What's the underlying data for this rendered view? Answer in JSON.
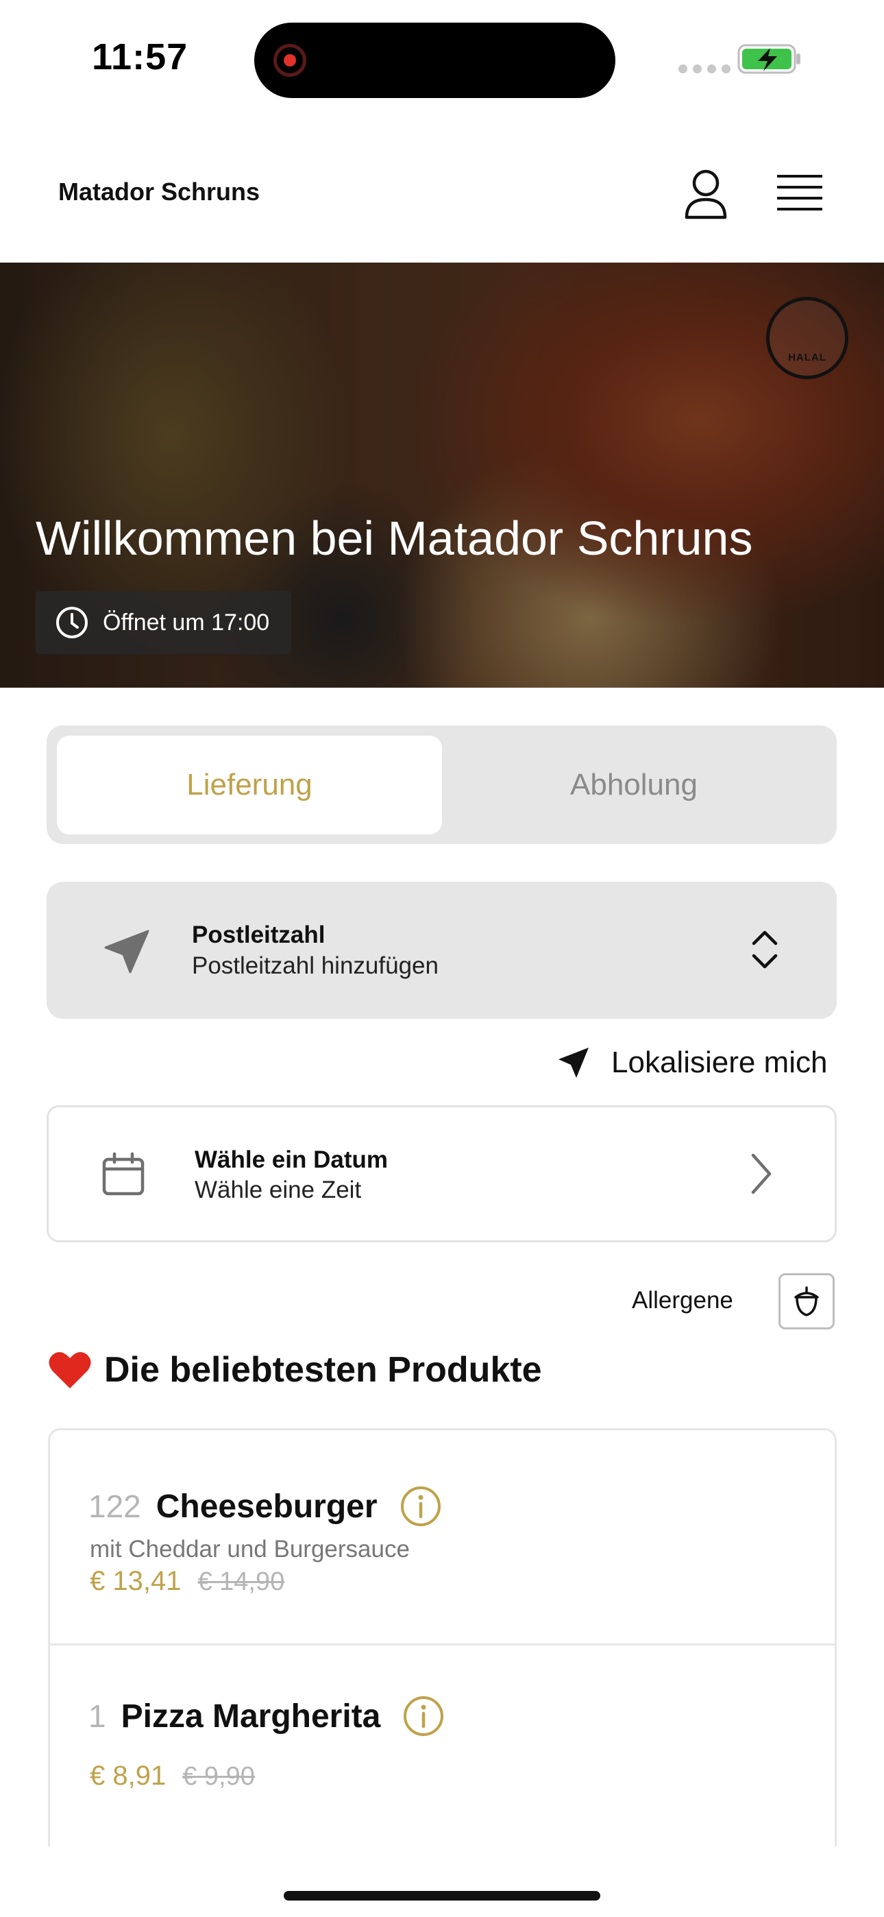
{
  "status_bar": {
    "time": "11:57"
  },
  "header": {
    "brand": "Matador Schruns",
    "user_icon": "user-icon",
    "menu_icon": "menu-icon"
  },
  "hero": {
    "title": "Willkommen bei Matador Schruns",
    "opening": "Öffnet um 17:00",
    "badge_text": "HALAL"
  },
  "tabs": [
    {
      "label": "Lieferung",
      "active": true
    },
    {
      "label": "Abholung",
      "active": false
    }
  ],
  "postcode": {
    "label": "Postleitzahl",
    "value": "Postleitzahl hinzufügen"
  },
  "locate": {
    "label": "Lokalisiere mich"
  },
  "date": {
    "label": "Wähle ein Datum",
    "value": "Wähle eine Zeit"
  },
  "allergens": {
    "label": "Allergene"
  },
  "section": {
    "emoji": "❤️",
    "title": "Die beliebtesten Produkte"
  },
  "products": [
    {
      "number": "122",
      "name": "Cheeseburger",
      "description": "mit Cheddar und Burgersauce",
      "price": "€ 13,41",
      "old_price": "€ 14,90"
    },
    {
      "number": "1",
      "name": "Pizza Margherita",
      "description": "",
      "price": "€ 8,91",
      "old_price": "€ 9,90"
    }
  ],
  "colors": {
    "accent": "#bfa24a",
    "card_gray": "#e6e6e6",
    "hero_text": "#ffffff"
  }
}
